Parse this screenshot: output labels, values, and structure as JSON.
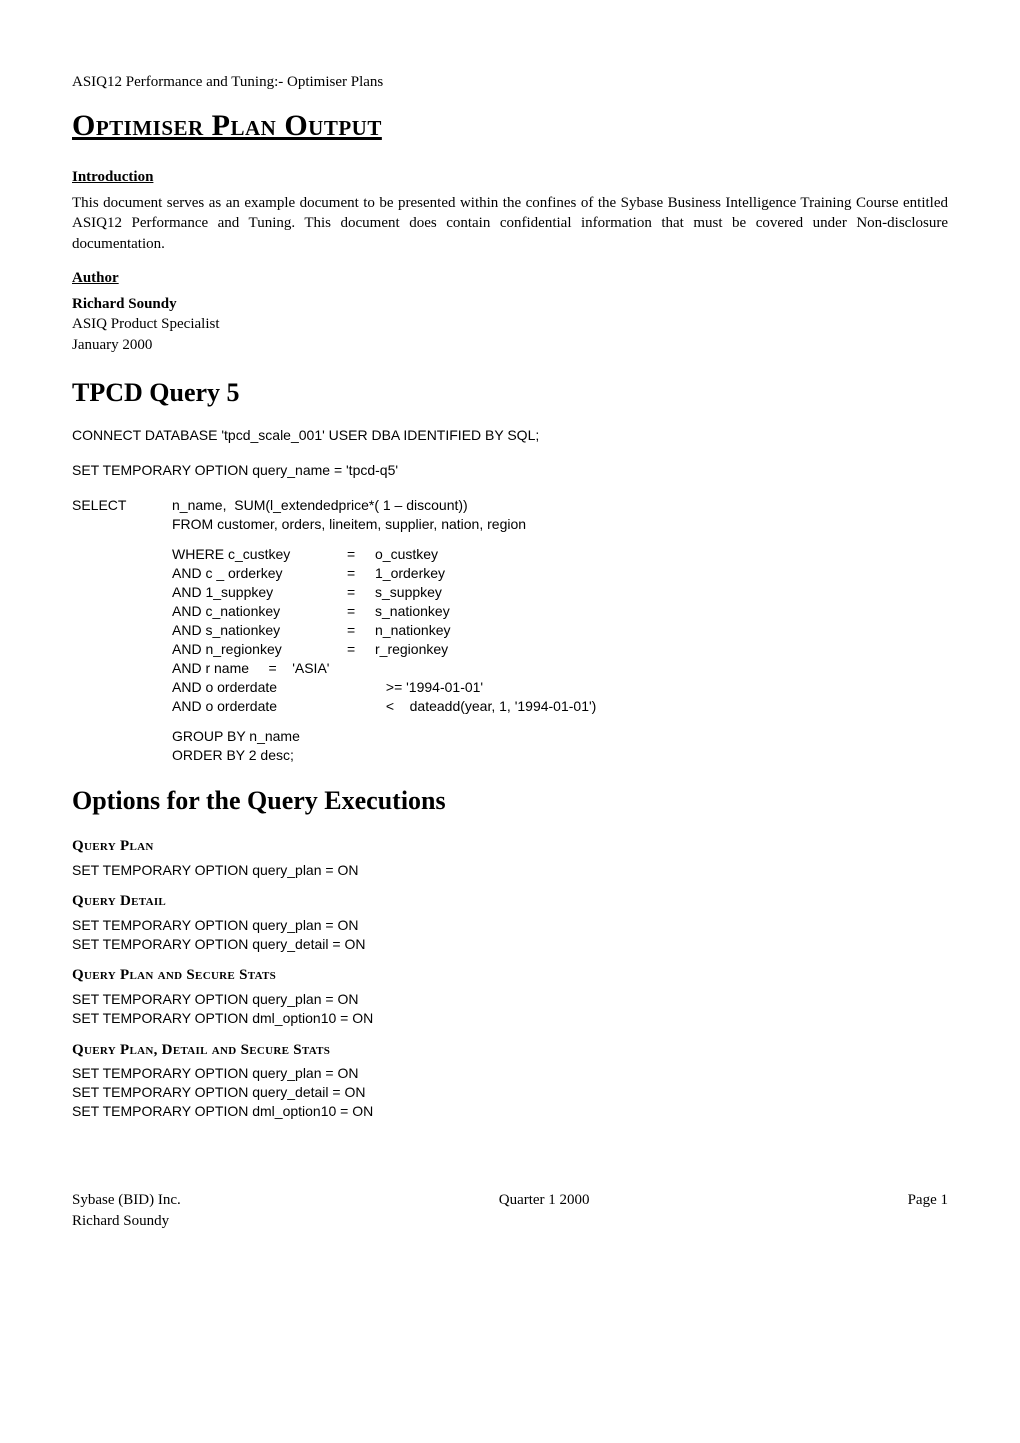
{
  "header": "ASIQ12 Performance and Tuning:- Optimiser Plans",
  "title": "Optimiser Plan Output",
  "intro_heading": "Introduction",
  "intro_text": "This document serves as an example document to be presented within the confines of the Sybase Business Intelligence Training Course entitled ASIQ12 Performance and Tuning.  This document does contain confidential information that must be covered under Non-disclosure documentation.",
  "author_heading": "Author",
  "author_name": "Richard Soundy",
  "author_role": "ASIQ Product Specialist",
  "author_date": "January 2000",
  "query_title": "TPCD Query 5",
  "connect_stmt": "CONNECT DATABASE 'tpcd_scale_001' USER DBA IDENTIFIED BY SQL;",
  "set_option_stmt": "SET TEMPORARY OPTION query_name = 'tpcd-q5'",
  "select": {
    "keyword": "SELECT",
    "line1": "n_name,  SUM(l_extendedprice*( 1 – discount))",
    "from": "FROM customer, orders, lineitem, supplier, nation, region",
    "where": [
      {
        "lhs": "WHERE c_custkey",
        "op": "=",
        "rhs": "o_custkey"
      },
      {
        "lhs": "AND c _ orderkey",
        "op": "=",
        "rhs": "1_orderkey"
      },
      {
        "lhs": "AND 1_suppkey",
        "op": "=",
        "rhs": "s_suppkey"
      },
      {
        "lhs": "AND c_nationkey",
        "op": "=",
        "rhs": "s_nationkey"
      },
      {
        "lhs": "AND s_nationkey",
        "op": "=",
        "rhs": "n_nationkey"
      },
      {
        "lhs": "AND n_regionkey",
        "op": "=",
        "rhs": "r_regionkey"
      }
    ],
    "name_line": "AND r name     =    'ASIA'",
    "date1": {
      "lhs": "AND o orderdate",
      "full": "          >= '1994-01-01'"
    },
    "date2": {
      "lhs": "AND o orderdate",
      "full": "          <    dateadd(year, 1, '1994-01-01')"
    },
    "group_by": "GROUP BY n_name",
    "order_by": "ORDER BY 2 desc;"
  },
  "options_title": "Options for the Query Executions",
  "sections": [
    {
      "heading": "Query Plan",
      "lines": [
        "SET TEMPORARY OPTION query_plan = ON"
      ]
    },
    {
      "heading": "Query Detail",
      "lines": [
        "SET TEMPORARY OPTION query_plan = ON",
        "SET TEMPORARY OPTION query_detail = ON"
      ]
    },
    {
      "heading": "Query Plan and Secure Stats",
      "lines": [
        "SET TEMPORARY OPTION query_plan = ON",
        "SET TEMPORARY OPTION dml_option10 = ON"
      ]
    },
    {
      "heading": "Query Plan, Detail and Secure Stats",
      "lines": [
        "SET TEMPORARY OPTION query_plan = ON",
        "SET TEMPORARY OPTION query_detail = ON",
        "SET TEMPORARY OPTION dml_option10 = ON"
      ]
    }
  ],
  "footer": {
    "left1": "Sybase (BID) Inc.",
    "left2": "Richard Soundy",
    "center": "Quarter 1 2000",
    "right": "Page 1"
  }
}
